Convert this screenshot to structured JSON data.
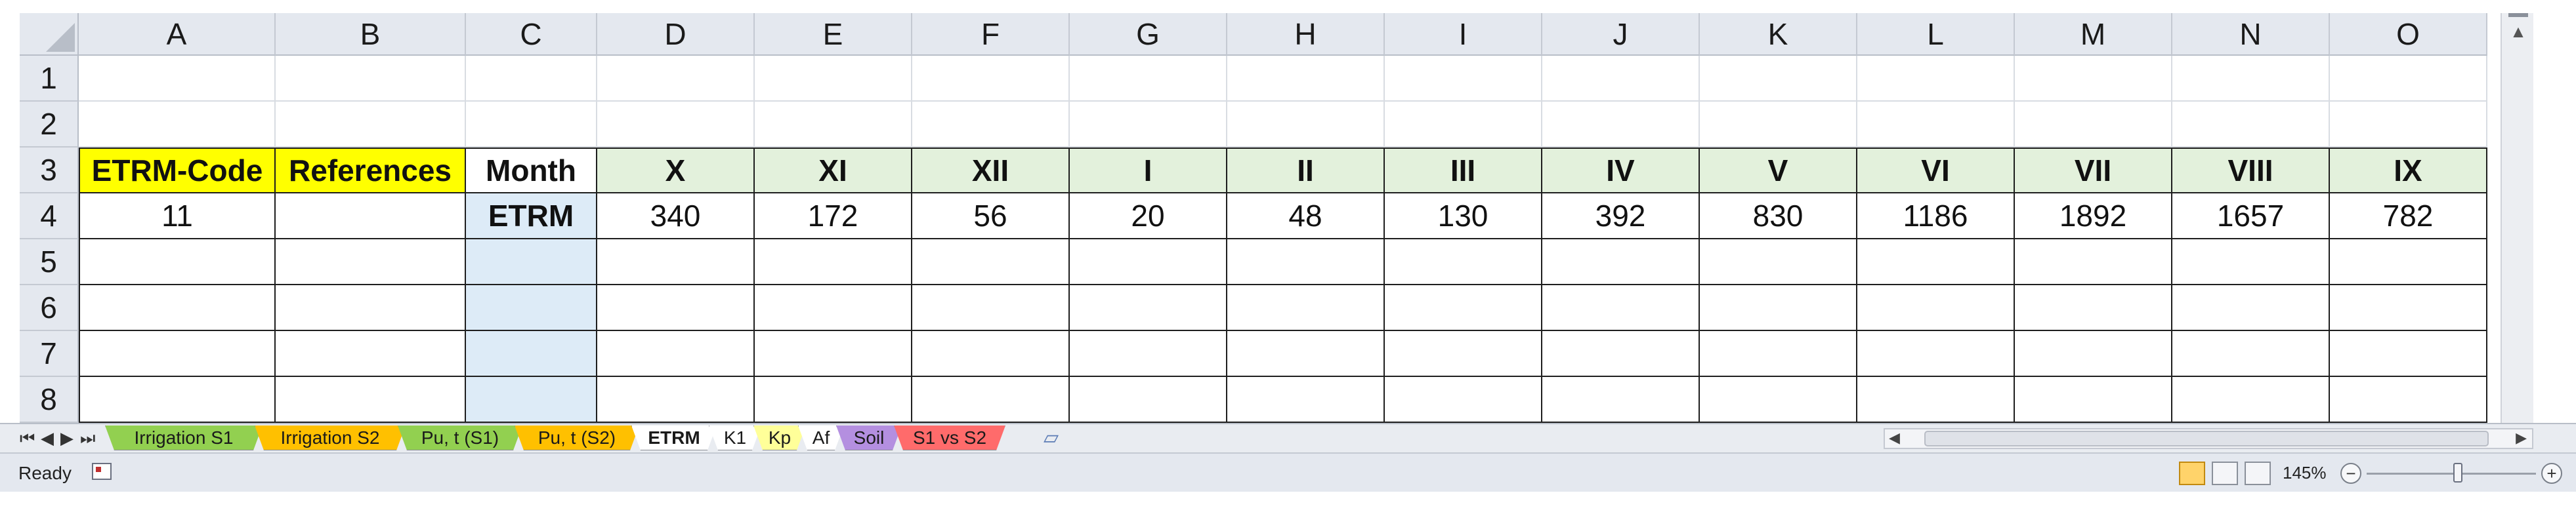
{
  "columns": [
    "A",
    "B",
    "C",
    "D",
    "E",
    "F",
    "G",
    "H",
    "I",
    "J",
    "K",
    "L",
    "M",
    "N",
    "O"
  ],
  "rows": [
    "1",
    "2",
    "3",
    "4",
    "5",
    "6",
    "7",
    "8"
  ],
  "row3": {
    "A": "ETRM-Code",
    "B": "References",
    "C": "Month",
    "D": "X",
    "E": "XI",
    "F": "XII",
    "G": "I",
    "H": "II",
    "I": "III",
    "J": "IV",
    "K": "V",
    "L": "VI",
    "M": "VII",
    "N": "VIII",
    "O": "IX"
  },
  "row4": {
    "A": "11",
    "B": "",
    "C": "ETRM",
    "D": "340",
    "E": "172",
    "F": "56",
    "G": "20",
    "H": "48",
    "I": "130",
    "J": "392",
    "K": "830",
    "L": "1186",
    "M": "1892",
    "N": "1657",
    "O": "782"
  },
  "tabs": [
    {
      "label": "Irrigation S1",
      "color": "#92d050",
      "active": false
    },
    {
      "label": "Irrigation S2",
      "color": "#ffc000",
      "active": false
    },
    {
      "label": "Pu, t (S1)",
      "color": "#92d050",
      "active": false
    },
    {
      "label": "Pu, t (S2)",
      "color": "#ffc000",
      "active": false
    },
    {
      "label": "ETRM",
      "color": "#ffffff",
      "active": true
    },
    {
      "label": "K1",
      "color": "#ffffff",
      "active": false
    },
    {
      "label": "Kp",
      "color": "#ffff99",
      "active": false
    },
    {
      "label": "Af",
      "color": "#ffffff",
      "active": false
    },
    {
      "label": "Soil",
      "color": "#b48fe0",
      "active": false
    },
    {
      "label": "S1 vs S2",
      "color": "#ff6b6b",
      "active": false
    }
  ],
  "status": {
    "ready": "Ready",
    "zoom": "145%"
  },
  "colors": {
    "header_yellow": "#ffff00",
    "header_green": "#e3f1dc",
    "etrm_blue": "#ddebf7"
  }
}
